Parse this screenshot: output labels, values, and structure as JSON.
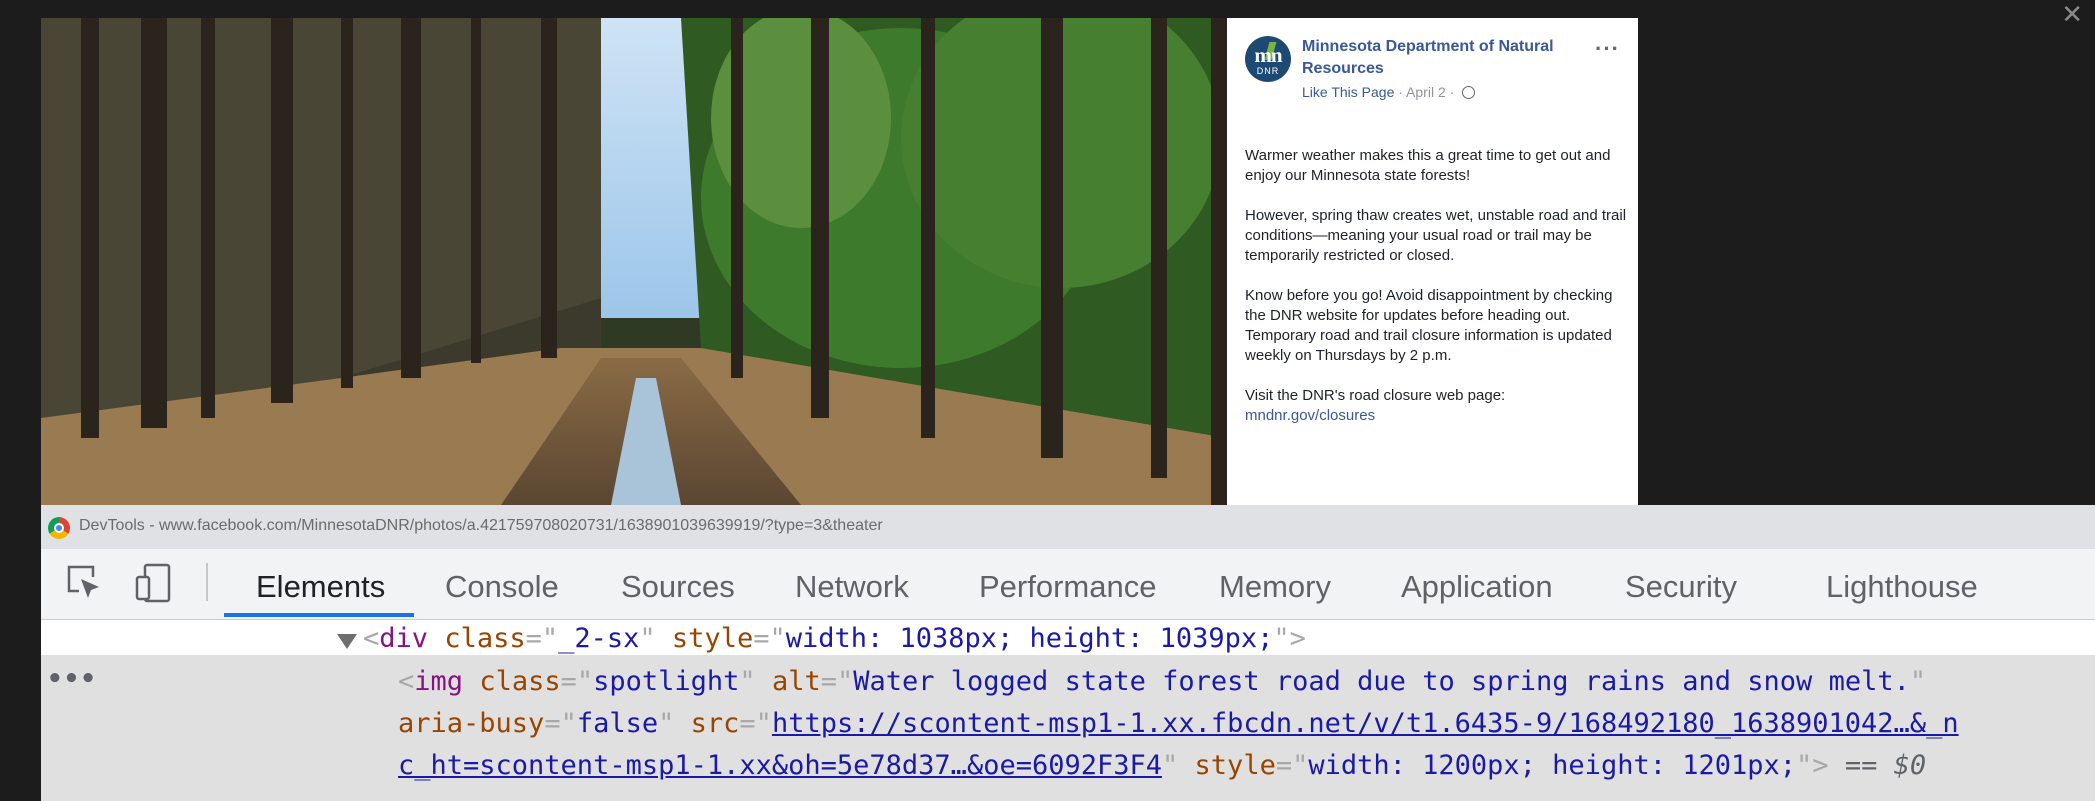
{
  "close_label": "✕",
  "post": {
    "page_name": "Minnesota Department of Natural Resources",
    "avatar_text": "mn",
    "avatar_subtext": "DNR",
    "like_page": "Like This Page",
    "separator": "·",
    "date": "April 2",
    "more": "···",
    "paragraphs": [
      "Warmer weather makes this a great time to get out and enjoy our Minnesota state forests!",
      "However, spring thaw creates wet, unstable road and trail conditions—meaning your usual road or trail may be temporarily restricted or closed.",
      "Know before you go! Avoid disappointment by checking the DNR website for updates before heading out. Temporary road and trail closure information is updated weekly on Thursdays by 2 p.m.",
      "Visit the DNR's road closure web page:"
    ],
    "link": "mndnr.gov/closures"
  },
  "devtools": {
    "window_title": "DevTools - www.facebook.com/MinnesotaDNR/photos/a.421759708020731/1638901039639919/?type=3&theater",
    "tabs": [
      "Elements",
      "Console",
      "Sources",
      "Network",
      "Performance",
      "Memory",
      "Application",
      "Security",
      "Lighthouse"
    ],
    "active_tab": "Elements",
    "code": {
      "div_tag": "div",
      "div_class_attr": "class",
      "div_class_val": "_2-sx",
      "div_style_attr": "style",
      "div_style_val": "width: 1038px; height: 1039px;",
      "img_tag": "img",
      "img_class_attr": "class",
      "img_class_val": "spotlight",
      "img_alt_attr": "alt",
      "img_alt_val": "Water logged state forest road due to spring rains and snow melt.",
      "busy_attr": "aria-busy",
      "busy_val": "false",
      "src_attr": "src",
      "src_val_1": "https://scontent-msp1-1.xx.fbcdn.net/v/t1.6435-9/168492180_1638901042…&_n",
      "src_val_2": "c_ht=scontent-msp1-1.xx&oh=5e78d37…&oe=6092F3F4",
      "img_style_attr": "style",
      "img_style_val": "width: 1200px; height: 1201px;",
      "selected_marker": "== $0",
      "ellipsis": "•••"
    }
  },
  "colors": {
    "link": "#385898",
    "devtools_active": "#1a73e8",
    "tag": "#881280",
    "attr": "#994500",
    "value": "#1a1aa6"
  }
}
